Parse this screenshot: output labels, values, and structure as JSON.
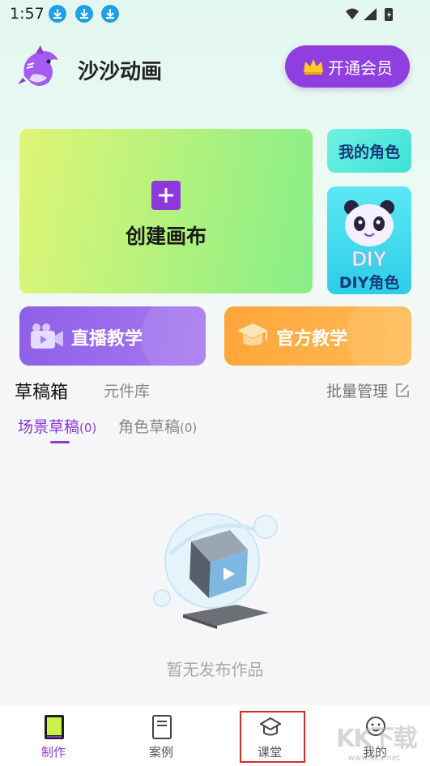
{
  "status_bar": {
    "time": "1:57"
  },
  "header": {
    "app_name": "沙沙动画",
    "vip_button": "开通会员"
  },
  "create_card": {
    "label": "创建画布"
  },
  "my_role_card": {
    "label": "我的角色"
  },
  "diy_card": {
    "label": "DIY角色",
    "art_text": "DIY"
  },
  "live_card": {
    "label": "直播教学"
  },
  "official_card": {
    "label": "官方教学"
  },
  "tabs": {
    "drafts": "草稿箱",
    "library": "元件库",
    "batch_manage": "批量管理"
  },
  "subtabs": {
    "scene": {
      "label": "场景草稿",
      "count": "(0)"
    },
    "role": {
      "label": "角色草稿",
      "count": "(0)"
    }
  },
  "empty_state": {
    "text": "暂无发布作品"
  },
  "bottom_nav": [
    {
      "label": "制作",
      "active": true
    },
    {
      "label": "案例",
      "active": false
    },
    {
      "label": "课堂",
      "active": false
    },
    {
      "label": "我的",
      "active": false
    }
  ],
  "watermark": {
    "text": "KK下载",
    "url": "www.kkx.net"
  },
  "colors": {
    "accent": "#8b38d9",
    "vip": "#8f3fe0",
    "live": "#8e5fe8",
    "official": "#ffa53a"
  }
}
